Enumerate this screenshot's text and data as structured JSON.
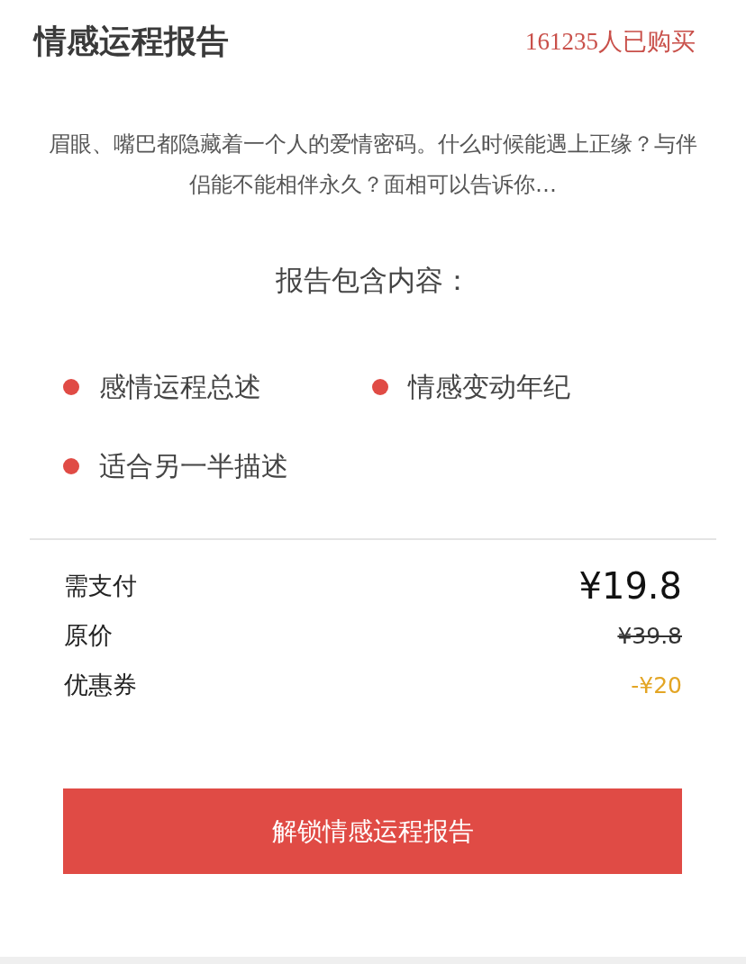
{
  "header": {
    "title": "情感运程报告",
    "purchase_count": "161235人已购买"
  },
  "description": "眉眼、嘴巴都隐藏着一个人的爱情密码。什么时候能遇上正缘？与伴侣能不能相伴永久？面相可以告诉你…",
  "contents": {
    "heading": "报告包含内容：",
    "items": [
      {
        "label": "感情运程总述"
      },
      {
        "label": "情感变动年纪"
      },
      {
        "label": "适合另一半描述"
      }
    ]
  },
  "prices": [
    {
      "kind": "total",
      "label": "需支付",
      "value": "¥19.8"
    },
    {
      "kind": "original",
      "label": "原价",
      "value": "¥39.8"
    },
    {
      "kind": "discount",
      "label": "优惠券",
      "value": "-¥20"
    }
  ],
  "button": {
    "label": "解锁情感运程报告"
  }
}
